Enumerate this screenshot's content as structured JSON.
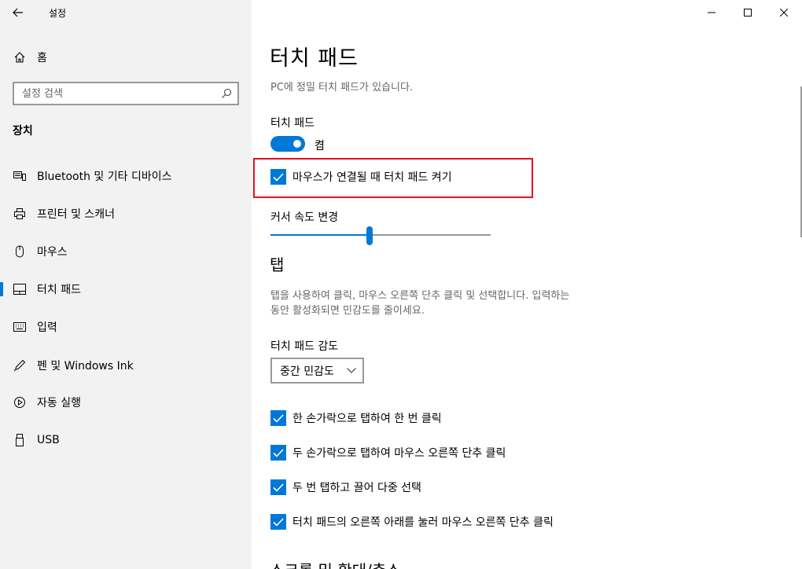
{
  "app": {
    "title": "설정"
  },
  "sidebar": {
    "home_label": "홈",
    "search_placeholder": "설정 검색",
    "section_title": "장치",
    "items": [
      {
        "label": "Bluetooth 및 기타 디바이스",
        "icon": "bluetooth-devices-icon"
      },
      {
        "label": "프린터 및 스캐너",
        "icon": "printer-icon"
      },
      {
        "label": "마우스",
        "icon": "mouse-icon"
      },
      {
        "label": "터치 패드",
        "icon": "touchpad-icon",
        "active": true
      },
      {
        "label": "입력",
        "icon": "keyboard-icon"
      },
      {
        "label": "펜 및 Windows Ink",
        "icon": "pen-icon"
      },
      {
        "label": "자동 실행",
        "icon": "autoplay-icon"
      },
      {
        "label": "USB",
        "icon": "usb-icon"
      }
    ]
  },
  "main": {
    "title": "터치 패드",
    "status_text": "PC에 정밀 터치 패드가 있습니다.",
    "touchpad_label": "터치 패드",
    "toggle_state": "켬",
    "leave_on_label": "마우스가 연결될 때 터치 패드 켜기",
    "cursor_speed_label": "커서 속도 변경",
    "cursor_speed_value": 0.45,
    "taps_header": "탭",
    "taps_desc_line1": "탭을 사용하여 클릭, 마우스 오른쪽 단추 클릭 및 선택합니다. 입력하는",
    "taps_desc_line2": "동안 활성화되면 민감도를 줄이세요.",
    "sensitivity_label": "터치 패드 감도",
    "sensitivity_value": "중간 민감도",
    "tap_options": [
      "한 손가락으로 탭하여 한 번 클릭",
      "두 손가락으로 탭하여 마우스 오른쪽 단추 클릭",
      "두 번 탭하고 끌어 다중 선택",
      "터치 패드의 오른쪽 아래를 눌러 마우스 오른쪽 단추 클릭"
    ],
    "scroll_header": "스크롤 및 확대/축소"
  },
  "colors": {
    "accent": "#0078d7",
    "highlight": "#e81123"
  }
}
